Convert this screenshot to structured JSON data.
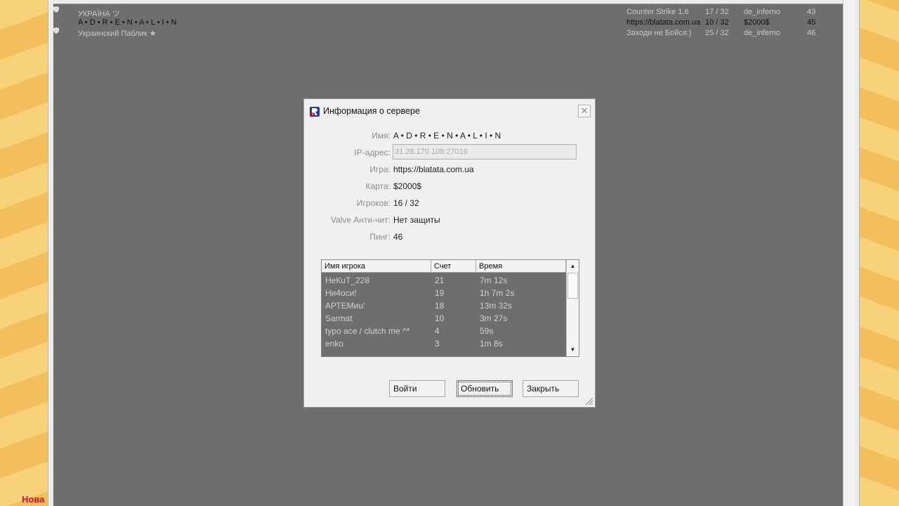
{
  "brand_label": "Нова",
  "server_list": {
    "rows": [
      {
        "name": "УКРАЇНА ツ",
        "game": "Counter Strike 1.6",
        "players": "17 / 32",
        "map": "de_inferno",
        "ping": "43"
      },
      {
        "name": "A • D • R • E • N • A • L • I • N",
        "game": "https://blatata.com.ua",
        "players": "10 / 32",
        "map": "$2000$",
        "ping": "45"
      },
      {
        "name": "Украинский Паблик ★",
        "game": "Заходи не Бойся:)",
        "players": "25 / 32",
        "map": "de_inferno",
        "ping": "46"
      }
    ]
  },
  "dialog": {
    "title": "Информация о сервере",
    "close_icon": "close-icon",
    "fields": {
      "name_label": "Имя:",
      "name_value": "A • D • R • E • N • A • L • I • N",
      "ip_label": "IP-адрес:",
      "ip_value": "31.28.170.108:27016",
      "game_label": "Игра:",
      "game_value": "https://blatata.com.ua",
      "map_label": "Карта:",
      "map_value": "$2000$",
      "players_label": "Игроков:",
      "players_value": "16 / 32",
      "vac_label": "Valve Анти-чит:",
      "vac_value": "Нет защиты",
      "ping_label": "Пинг:",
      "ping_value": "46"
    },
    "players_table": {
      "headers": [
        "Имя игрока",
        "Счет",
        "Время"
      ],
      "rows": [
        [
          "НеКuТ_228",
          "21",
          "7m 12s"
        ],
        [
          "Ни4оси!",
          "19",
          "1h 7m 2s"
        ],
        [
          "АРТЕМиu'",
          "18",
          "13m 32s"
        ],
        [
          "Sarmat",
          "10",
          "3m 27s"
        ],
        [
          "typo ace / clutch me ^*",
          "4",
          "59s"
        ],
        [
          "enko",
          "3",
          "1m 8s"
        ]
      ]
    },
    "buttons": {
      "join": "Войти",
      "refresh": "Обновить",
      "close": "Закрыть"
    }
  },
  "colors": {
    "list_background": "#6e6e6e",
    "dialog_background": "#f0f0f0",
    "brand_red": "#c8102e"
  }
}
